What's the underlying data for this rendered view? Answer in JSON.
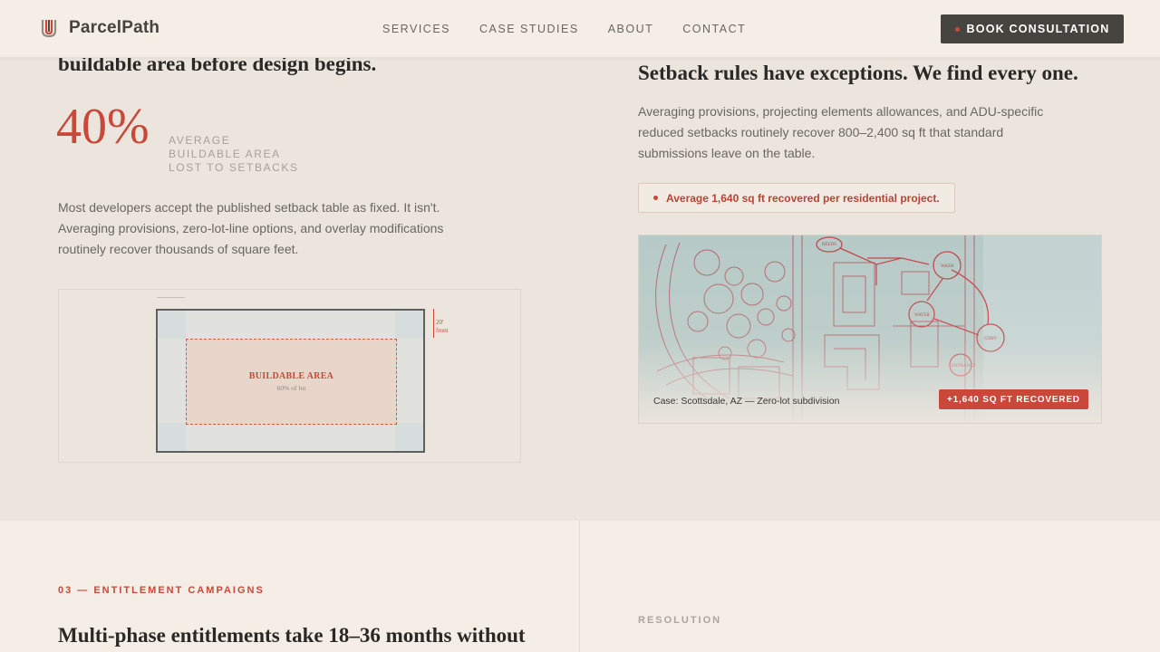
{
  "brand": {
    "name": "ParcelPath",
    "logo_icon": "parcel-logo-icon"
  },
  "nav": {
    "links": [
      "SERVICES",
      "CASE STUDIES",
      "ABOUT",
      "CONTACT"
    ],
    "cta_label": "BOOK CONSULTATION"
  },
  "setbacks": {
    "left": {
      "heading": "buildable area before design begins.",
      "stat_value": "40%",
      "stat_label_lines": [
        "AVERAGE",
        "BUILDABLE AREA",
        "LOST TO SETBACKS"
      ],
      "body_lines": [
        "Most developers accept the published setback table as fixed. It isn't.",
        "Averaging provisions, zero-lot-line options, and overlay modifications",
        "routinely recover thousands of square feet."
      ],
      "diagram": {
        "buildable_title": "BUILDABLE AREA",
        "buildable_sub": "60% of lot",
        "dim_label_value": "20'",
        "dim_label_unit": "front"
      }
    },
    "right": {
      "heading": "Setback rules have exceptions. We find every one.",
      "body_lines": [
        "Averaging provisions, projecting elements allowances, and ADU-specific",
        "reduced setbacks routinely recover 800–2,400 sq ft that standard",
        "submissions leave on the table."
      ],
      "pill_text": "Average 1,640 sq ft recovered per residential project.",
      "case_caption": "Case: Scottsdale, AZ — Zero-lot subdivision",
      "case_badge": "+1,640 SQ FT RECOVERED",
      "plan_labels": [
        "REEDS",
        "WASH",
        "WATER",
        "CONV",
        "ENTRANCE"
      ]
    }
  },
  "entitlements": {
    "eyebrow": "03 — ENTITLEMENT CAMPAIGNS",
    "heading": "Multi-phase entitlements take 18–36 months without",
    "resolution_label": "RESOLUTION"
  },
  "colors": {
    "accent": "#c9483a",
    "dark": "#46443f",
    "bg": "#f4eee7",
    "section_bg": "#ebe5dd"
  }
}
